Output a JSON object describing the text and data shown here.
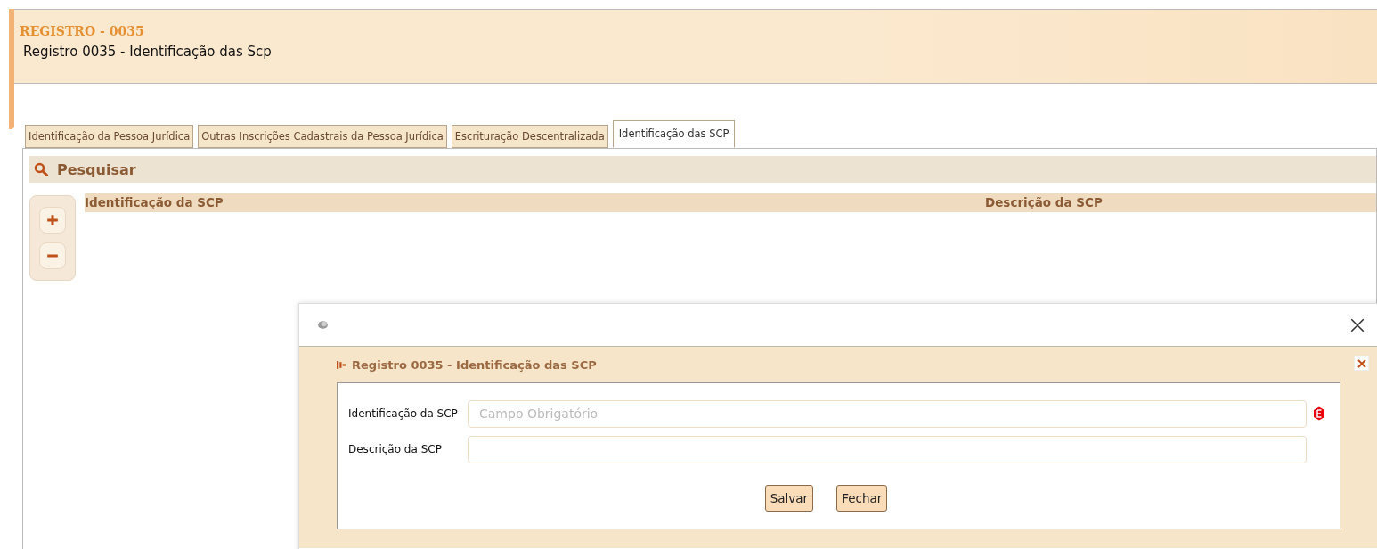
{
  "header": {
    "code": "REGISTRO - 0035",
    "title": "Registro 0035 - Identificação das Scp"
  },
  "tabs": [
    {
      "label": "Identificação da Pessoa Jurídica",
      "selected": false
    },
    {
      "label": "Outras Inscrições Cadastrais da Pessoa Jurídica",
      "selected": false
    },
    {
      "label": "Escrituração Descentralizada",
      "selected": false
    },
    {
      "label": "Identificação das SCP",
      "selected": true
    }
  ],
  "search_bar": {
    "title": "Pesquisar"
  },
  "table": {
    "columns": [
      "Identificação da SCP",
      "Descrição da SCP"
    ]
  },
  "dialog": {
    "panel_title": "Registro 0035 - Identificação das SCP",
    "fields": [
      {
        "label": "Identificação da SCP",
        "placeholder": "Campo Obrigatório",
        "error": true
      },
      {
        "label": "Descrição da SCP",
        "error": false
      }
    ],
    "buttons": [
      "Salvar",
      "Fechar"
    ]
  }
}
